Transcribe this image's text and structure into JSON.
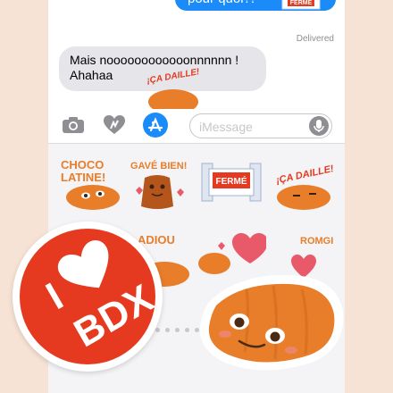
{
  "conversation": {
    "outgoing_text": "pour quoi?!",
    "status": "Delivered",
    "incoming_text_line1": "Mais noooooooooooonnnnnn !",
    "incoming_text_line2": "Ahahaa"
  },
  "composer": {
    "placeholder": "iMessage"
  },
  "stickers": {
    "choco_line1": "CHOCO",
    "choco_line2": "LATINE!",
    "gave_bien": "GAVÉ BIEN!",
    "ferme": "FERMÉ",
    "ca_daille": "¡ÇA DAILLE!",
    "adiou_line1": "ADIOU",
    "adiou_line2": "...",
    "romgi": "ROMGI",
    "bdx_line1": "I",
    "bdx_line2": "BDX"
  },
  "colors": {
    "ios_blue": "#1a8bf8",
    "canele_orange": "#e87d2a",
    "sticker_red": "#e63a20",
    "heart_red": "#e85a6a"
  }
}
